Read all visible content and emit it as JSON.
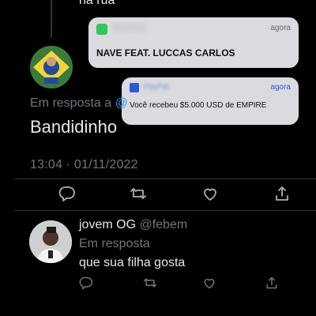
{
  "tweet_main": {
    "previous_text_fragment": "na rua",
    "reply_label": "Em resposta a",
    "reply_mention": "@",
    "text": "Bandidinho",
    "timestamp": "13:04 · 01/11/2022"
  },
  "notifications": [
    {
      "app": "░░░░░░",
      "time": "agora",
      "message": "NAVE FEAT. LUCCAS CARLOS",
      "icon_color": "#34c759"
    },
    {
      "app": "PayPal",
      "time": "agora",
      "message": "Você recebeu $5.000 USD de EMPIRE",
      "icon_color": "#2a5bd7"
    }
  ],
  "reply_tweet": {
    "name": "jovem OG",
    "handle": "@febem",
    "reply_label": "Em resposta",
    "text": "que sua filha gosta"
  },
  "colors": {
    "background": "#000000",
    "text": "#e7e9ea",
    "muted": "#71767b",
    "link": "#1d9bf0",
    "divider": "#2f3336"
  },
  "icons": [
    "reply-icon",
    "retweet-icon",
    "like-icon",
    "share-icon"
  ]
}
